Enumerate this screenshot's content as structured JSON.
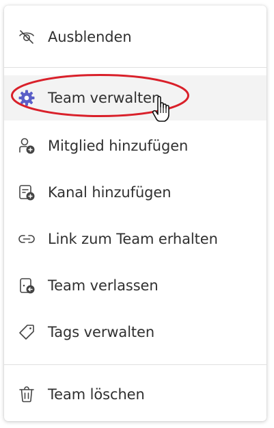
{
  "menu": {
    "items": [
      {
        "label": "Ausblenden",
        "icon": "eye-off-icon"
      },
      {
        "label": "Team verwalten",
        "icon": "gear-icon"
      },
      {
        "label": "Mitglied hinzufügen",
        "icon": "add-person-icon"
      },
      {
        "label": "Kanal hinzufügen",
        "icon": "add-channel-icon"
      },
      {
        "label": "Link zum Team erhalten",
        "icon": "link-icon"
      },
      {
        "label": "Team verlassen",
        "icon": "leave-team-icon"
      },
      {
        "label": "Tags verwalten",
        "icon": "tag-icon"
      },
      {
        "label": "Team löschen",
        "icon": "trash-icon"
      }
    ]
  },
  "colors": {
    "accent": "#5b5fc7",
    "highlight_ring": "#d9202a",
    "text": "#303030",
    "hover_background": "#f3f3f3"
  }
}
